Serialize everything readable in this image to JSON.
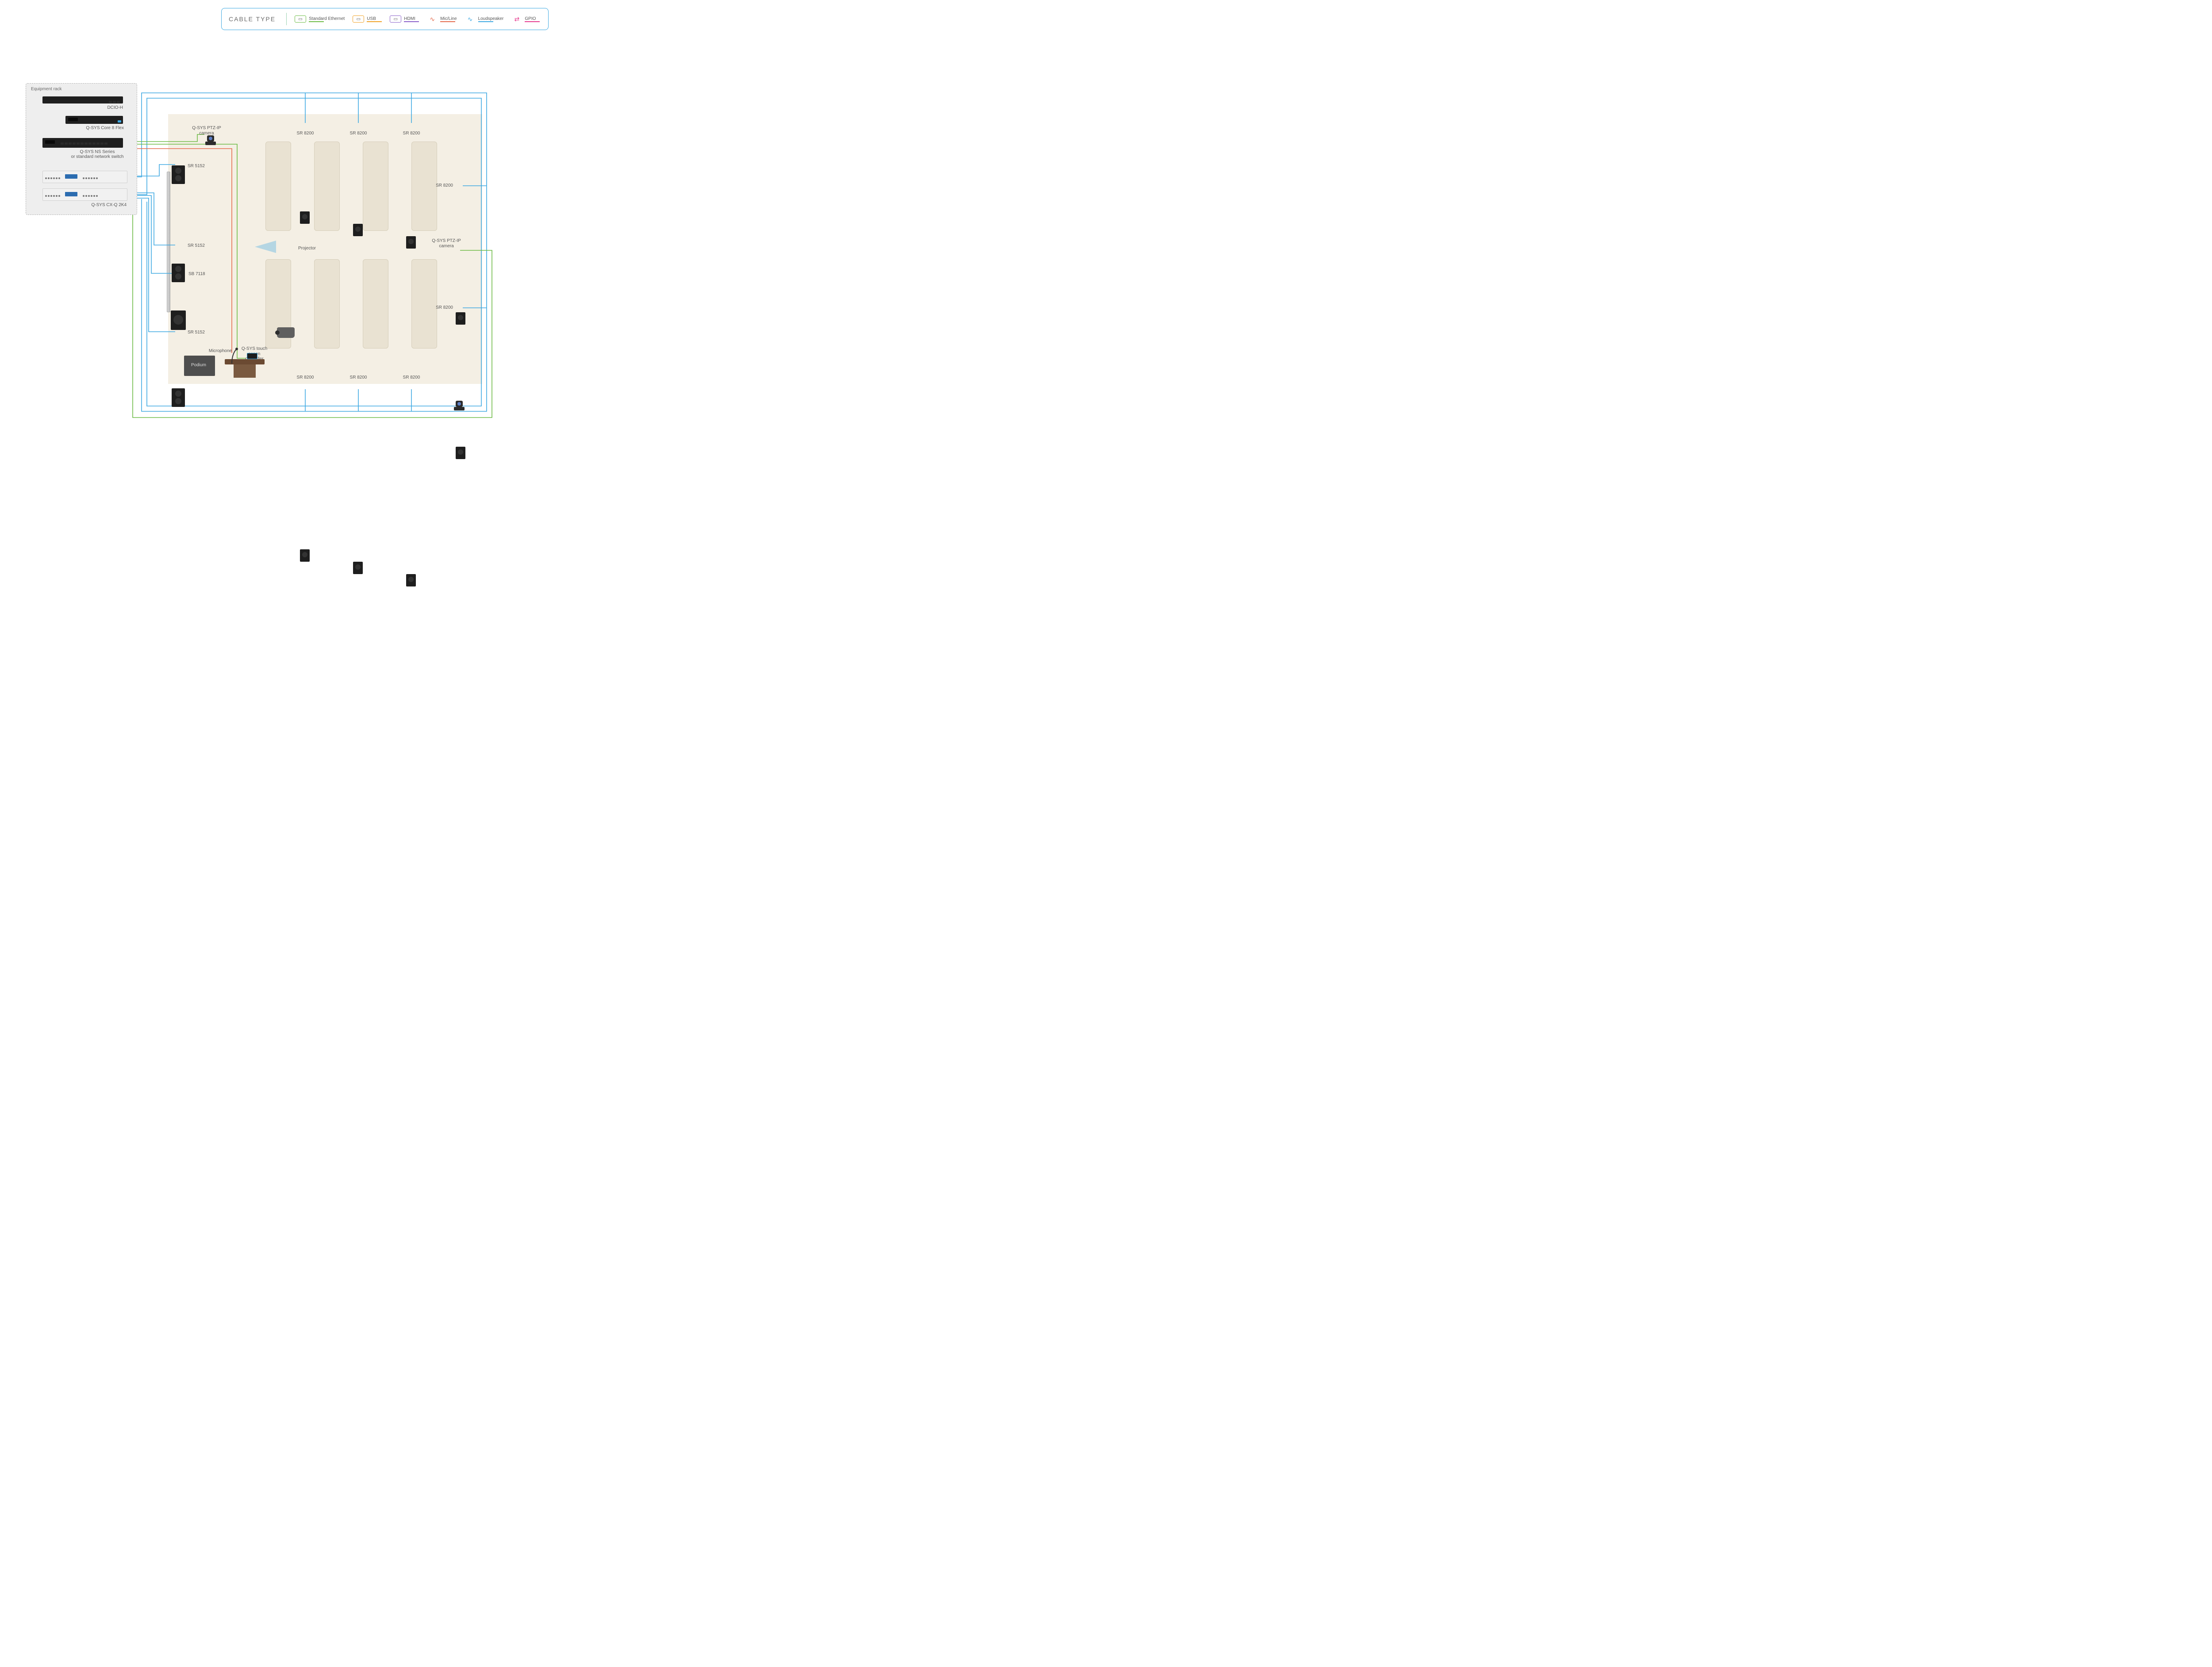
{
  "legend": {
    "title": "CABLE TYPE",
    "items": [
      {
        "key": "ethernet",
        "label": "Standard Ethernet",
        "color": "#6dbb45"
      },
      {
        "key": "usb",
        "label": "USB",
        "color": "#f0a227"
      },
      {
        "key": "hdmi",
        "label": "HDMI",
        "color": "#8a5fc9"
      },
      {
        "key": "micline",
        "label": "Mic/Line",
        "color": "#e46a4c"
      },
      {
        "key": "loudspeaker",
        "label": "Loudspeaker",
        "color": "#3ea9e2"
      },
      {
        "key": "gpio",
        "label": "GPIO",
        "color": "#e63b8f"
      }
    ]
  },
  "rack": {
    "title": "Equipment rack",
    "devices": {
      "dcio": "DCIO-H",
      "core": "Q-SYS Core 8 Flex",
      "switch1": "Q-SYS NS Series",
      "switch2": "or standard network switch",
      "amp": "Q-SYS CX-Q 2K4"
    }
  },
  "room": {
    "camera_label": "Q-SYS PTZ-IP\ncamera",
    "projector_label": "Projector",
    "podium_label": "Podium",
    "mic_label": "Microphone",
    "tsc_label": "Q-SYS touch\nsceen controller",
    "front_speakers": [
      {
        "model": "SR 5152"
      },
      {
        "model": "SR 5152"
      },
      {
        "model": "SB 7118"
      },
      {
        "model": "SR 5152"
      }
    ],
    "surround_top": [
      "SR 8200",
      "SR 8200",
      "SR 8200"
    ],
    "surround_bottom": [
      "SR 8200",
      "SR 8200",
      "SR 8200"
    ],
    "surround_right": [
      "SR 8200",
      "SR 8200"
    ],
    "camera2_label": "Q-SYS PTZ-IP\ncamera"
  }
}
